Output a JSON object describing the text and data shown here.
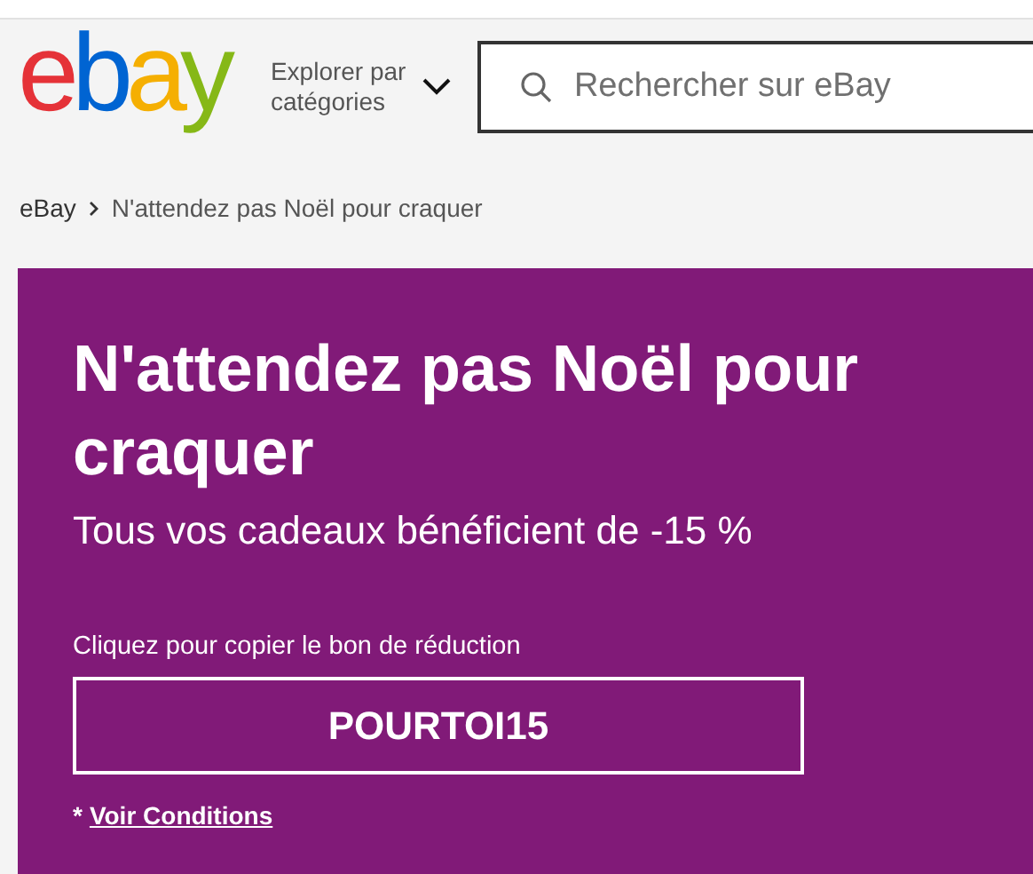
{
  "header": {
    "logo": [
      {
        "text": "e",
        "color": "#e53238"
      },
      {
        "text": "b",
        "color": "#0064d2"
      },
      {
        "text": "a",
        "color": "#f5af02"
      },
      {
        "text": "y",
        "color": "#86b817"
      }
    ],
    "categories_button": "Explorer par catégories",
    "search": {
      "placeholder": "Rechercher sur eBay"
    }
  },
  "breadcrumb": [
    "eBay",
    "N'attendez pas Noël pour craquer"
  ],
  "banner": {
    "title": "N'attendez pas Noël pour craquer",
    "subtitle": "Tous vos cadeaux bénéficient de -15 %",
    "coupon_label": "Cliquez pour copier le bon de réduction",
    "coupon_code": "POURTOI15",
    "terms_prefix": "*",
    "terms_link": "Voir Conditions"
  }
}
